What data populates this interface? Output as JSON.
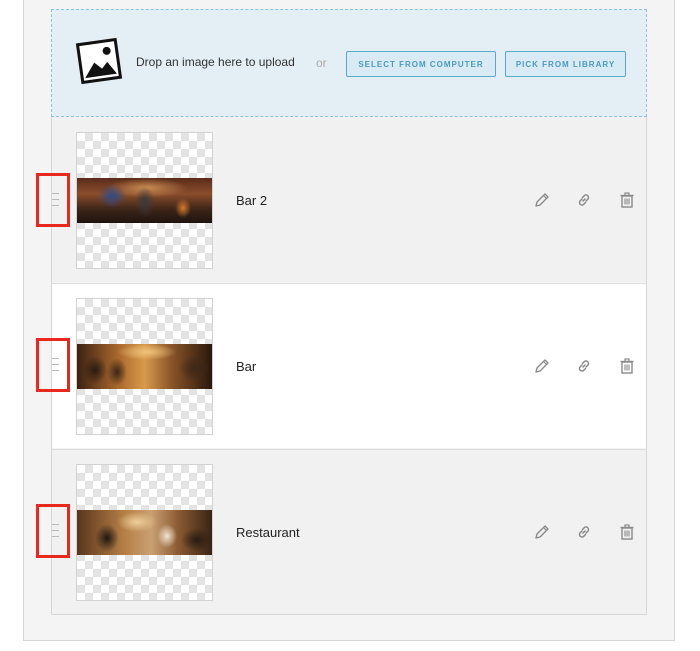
{
  "upload": {
    "drop_text": "Drop an image here to upload",
    "or_text": "or",
    "select_button": "SELECT FROM COMPUTER",
    "library_button": "PICK FROM LIBRARY"
  },
  "images": [
    {
      "title": "Bar 2"
    },
    {
      "title": "Bar"
    },
    {
      "title": "Restaurant"
    }
  ],
  "icons": {
    "upload": "image-upload-icon",
    "handle": "drag-handle-icon",
    "edit": "pencil-icon",
    "link": "link-icon",
    "delete": "trash-icon"
  },
  "colors": {
    "dropzone_bg": "#e3eef5",
    "dropzone_border": "#8fc1d8",
    "button_text": "#4b9bbb",
    "highlight": "#e8281c"
  }
}
